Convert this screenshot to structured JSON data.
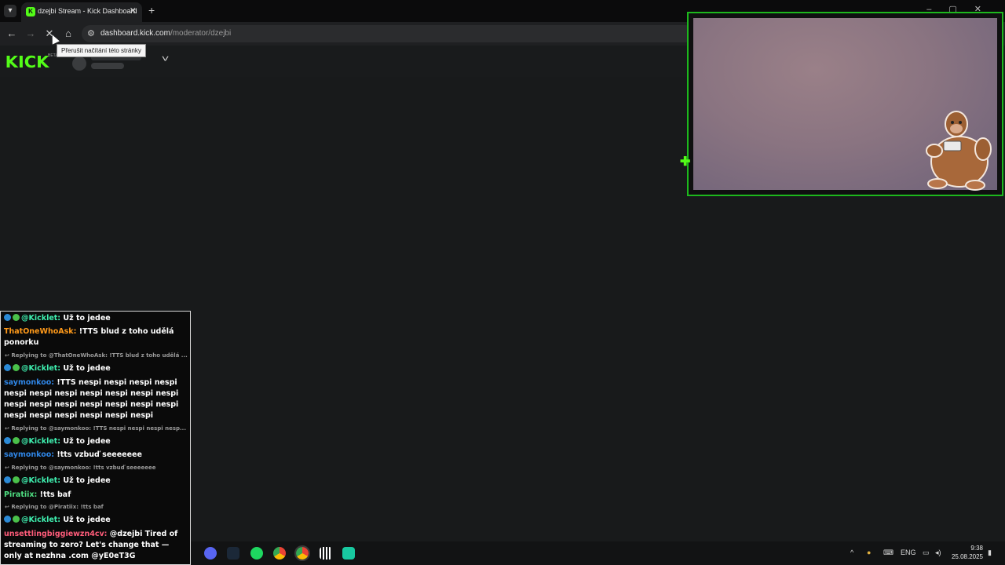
{
  "browser": {
    "tab_title": "dzejbi Stream - Kick Dashboard",
    "tab_favicon": "K",
    "new_tab": "+",
    "url_host": "dashboard.kick.com",
    "url_path": "/moderator/dzejbi",
    "tooltip": "Přerušit načítání této stránky",
    "nav": {
      "back": "←",
      "forward": "→",
      "stop": "✕",
      "home": "⌂",
      "site_info": "⚙"
    }
  },
  "page": {
    "logo": "KICK",
    "beta": "BETA",
    "dropdown_icon": "chevron-down-icon"
  },
  "chat": {
    "messages": [
      {
        "user": "@Kicklet:",
        "text": "Už to jedee",
        "bot": true
      },
      {
        "user": "ThatOneWhoAsk:",
        "text": "!TTS blud z toho udělá ponorku",
        "reply": "Replying to @ThatOneWhoAsk: !TTS blud z toho udělá ..."
      },
      {
        "user": "@Kicklet:",
        "text": "Už to jedee",
        "bot": true
      },
      {
        "user": "saymonkoo:",
        "text": "!TTS nespi nespi nespi nespi nespi nespi nespi nespi nespi nespi nespi nespi nespi nespi nespi nespi nespi nespi nespi nespi nespi nespi nespi nespi",
        "reply": "Replying to @saymonkoo: !TTS nespi nespi nespi nesp..."
      },
      {
        "user": "@Kicklet:",
        "text": "Už to jedee",
        "bot": true
      },
      {
        "user": "saymonkoo:",
        "text": "!tts vzbuď seeeeeee",
        "reply": "Replying to @saymonkoo: !tts vzbuď seeeeeee"
      },
      {
        "user": "@Kicklet:",
        "text": "Už to jedee",
        "bot": true
      },
      {
        "user": "Piratiix:",
        "text": "!tts baf",
        "reply": "Replying to @Piratiix: !tts baf"
      },
      {
        "user": "@Kicklet:",
        "text": "Už to jedee",
        "bot": true
      },
      {
        "user": "unsettlingbiggiewzn4cv:",
        "text": "@dzejbi Tired of streaming to zero? Let's change that — only at nezhna .com @yE0eT3G"
      }
    ]
  },
  "taskbar": {
    "language": "ENG",
    "time": "9:38",
    "date": "25.08.2025",
    "tray_chevron": "^"
  },
  "colors": {
    "kick_green": "#53fc18",
    "cam_border": "#1db81d"
  }
}
